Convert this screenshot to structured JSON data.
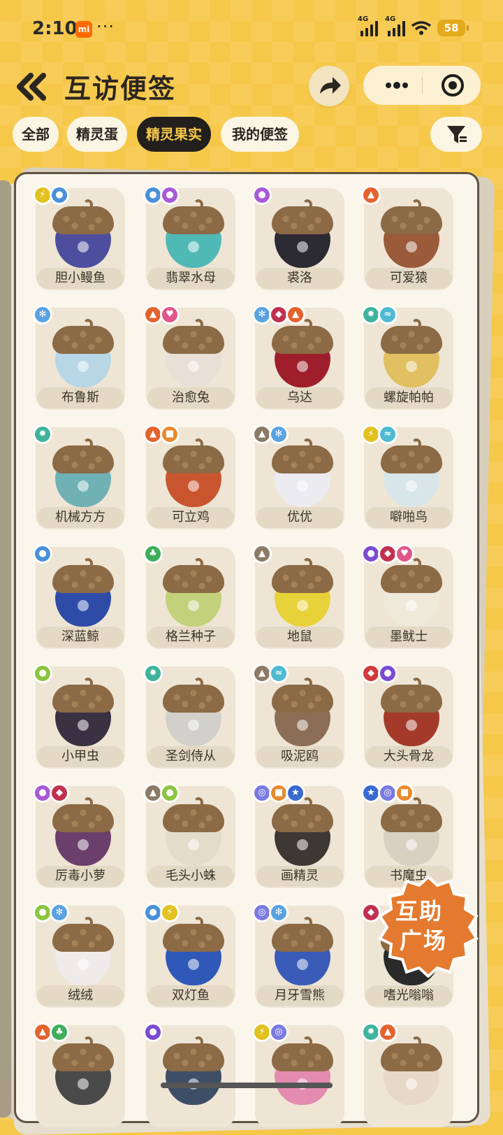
{
  "status_bar": {
    "time": "2:10",
    "mi_label": "mi",
    "more": "···",
    "net1": "4G",
    "net2": "4G",
    "battery": "58"
  },
  "header": {
    "title": "互访便签"
  },
  "tabs": [
    {
      "label": "全部",
      "active": false
    },
    {
      "label": "精灵蛋",
      "active": false
    },
    {
      "label": "精灵果实",
      "active": true
    },
    {
      "label": "我的便签",
      "active": false
    }
  ],
  "colors": {
    "accent": "#f6c84a",
    "dark": "#221f1c"
  },
  "cards": [
    {
      "name": "胆小鳗鱼",
      "color": "#4d4f9e",
      "badges": [
        "electric",
        "water"
      ]
    },
    {
      "name": "翡翠水母",
      "color": "#4fb9b6",
      "badges": [
        "water",
        "poison"
      ]
    },
    {
      "name": "裘洛",
      "color": "#2c2a33",
      "badges": [
        "poison"
      ]
    },
    {
      "name": "可爱猿",
      "color": "#9b5a3a",
      "badges": [
        "fire"
      ]
    },
    {
      "name": "布鲁斯",
      "color": "#b7d6e6",
      "badges": [
        "ice"
      ]
    },
    {
      "name": "治愈兔",
      "color": "#e8e0d6",
      "badges": [
        "fire",
        "heal"
      ]
    },
    {
      "name": "乌达",
      "color": "#9e1f2b",
      "badges": [
        "ice",
        "demon",
        "fire"
      ]
    },
    {
      "name": "螺旋帕帕",
      "color": "#e0c060",
      "badges": [
        "machine",
        "wing"
      ]
    },
    {
      "name": "机械方方",
      "color": "#6fb1b4",
      "badges": [
        "machine"
      ]
    },
    {
      "name": "可立鸡",
      "color": "#c9552e",
      "badges": [
        "fire",
        "cute"
      ]
    },
    {
      "name": "优优",
      "color": "#ecebf0",
      "badges": [
        "ground",
        "ice"
      ]
    },
    {
      "name": "噼啪鸟",
      "color": "#d8e6ea",
      "badges": [
        "electric",
        "wing"
      ]
    },
    {
      "name": "深蓝鲸",
      "color": "#2e4ba8",
      "badges": [
        "water"
      ]
    },
    {
      "name": "格兰种子",
      "color": "#c3d17a",
      "badges": [
        "grass"
      ]
    },
    {
      "name": "地鼠",
      "color": "#e8d23a",
      "badges": [
        "ground"
      ]
    },
    {
      "name": "墨鱿士",
      "color": "#efe9da",
      "badges": [
        "ghost",
        "demon",
        "heal"
      ]
    },
    {
      "name": "小甲虫",
      "color": "#3a3142",
      "badges": [
        "bug"
      ]
    },
    {
      "name": "圣剑侍从",
      "color": "#d1d0cb",
      "badges": [
        "machine"
      ]
    },
    {
      "name": "吸泥鸥",
      "color": "#8c6e56",
      "badges": [
        "ground",
        "wing"
      ]
    },
    {
      "name": "大头骨龙",
      "color": "#a43a2a",
      "badges": [
        "dragon",
        "ghost"
      ]
    },
    {
      "name": "厉毒小萝",
      "color": "#6b3f6b",
      "badges": [
        "poison",
        "demon"
      ]
    },
    {
      "name": "毛头小蛛",
      "color": "#e4dccb",
      "badges": [
        "ground",
        "bug"
      ]
    },
    {
      "name": "画精灵",
      "color": "#3e3834",
      "badges": [
        "spiral",
        "cute",
        "star"
      ]
    },
    {
      "name": "书魔虫",
      "color": "#d8d1c2",
      "badges": [
        "star",
        "spiral",
        "cute"
      ]
    },
    {
      "name": "绒绒",
      "color": "#efebea",
      "badges": [
        "bug",
        "ice"
      ]
    },
    {
      "name": "双灯鱼",
      "color": "#2f58b8",
      "badges": [
        "water",
        "electric"
      ]
    },
    {
      "name": "月牙雪熊",
      "color": "#3a5bb8",
      "badges": [
        "spiral",
        "ice"
      ]
    },
    {
      "name": "嗜光嗡嗡",
      "color": "#2a2a2a",
      "badges": [
        "demon"
      ]
    },
    {
      "name": "",
      "color": "#4a4a4a",
      "badges": [
        "fire",
        "grass"
      ]
    },
    {
      "name": "",
      "color": "#3e4e66",
      "badges": [
        "ghost"
      ]
    },
    {
      "name": "",
      "color": "#e48cb0",
      "badges": [
        "electric",
        "spiral"
      ]
    },
    {
      "name": "",
      "color": "#e8d8c8",
      "badges": [
        "machine",
        "fire"
      ]
    }
  ],
  "fab": {
    "line1": "互助",
    "line2": "广场"
  }
}
